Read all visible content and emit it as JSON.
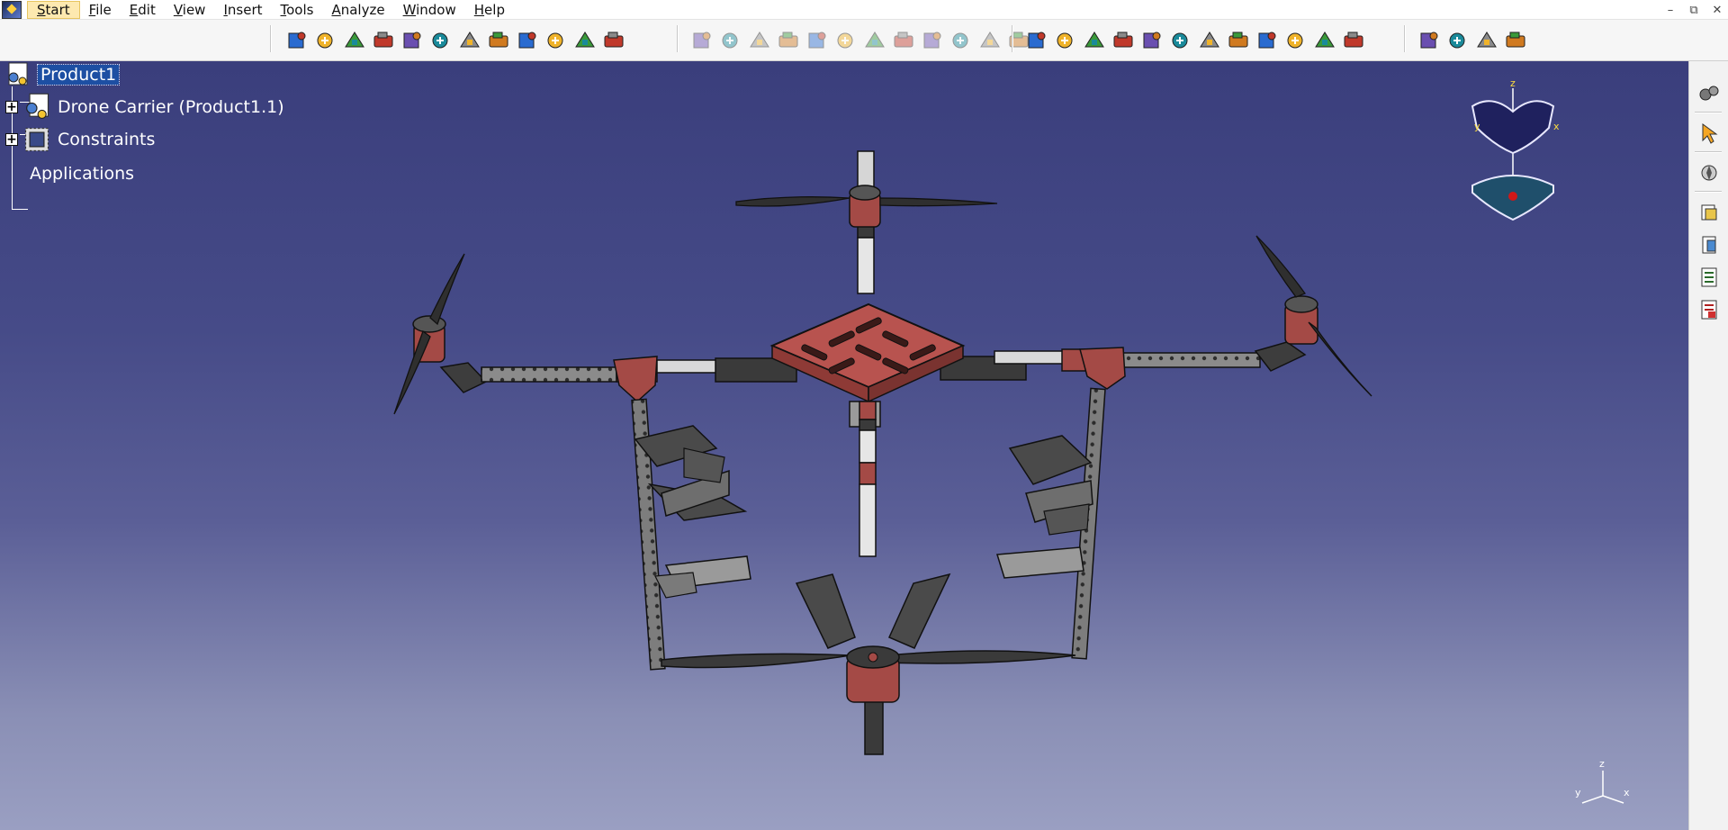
{
  "menu": {
    "items": [
      "Start",
      "File",
      "Edit",
      "View",
      "Insert",
      "Tools",
      "Analyze",
      "Window",
      "Help"
    ]
  },
  "tree": {
    "root": "Product1",
    "child_1": "Drone Carrier (Product1.1)",
    "child_2": "Constraints",
    "child_3": "Applications"
  },
  "compass": {
    "z_label": "z",
    "x_label": "x",
    "y_label": "y"
  },
  "axis": {
    "z_label": "z",
    "x_label": "x",
    "y_label": "y"
  },
  "toolbar_icons": [
    "fly-mode-icon",
    "fit-all-icon",
    "pan-icon",
    "rotate-icon",
    "zoom-in-icon",
    "zoom-out-icon",
    "normal-view-icon",
    "multi-view-icon",
    "iso-view-icon",
    "render-style-icon",
    "hide-show-icon",
    "swap-visible-icon",
    "manipulate-icon",
    "snap-icon",
    "explode-icon",
    "stop-manipulation-icon",
    "bill-of-material-icon",
    "measure-icon",
    "update-icon",
    "existing-component-icon",
    "new-part-icon",
    "new-product-icon",
    "new-component-icon",
    "replace-icon",
    "graph-tree-icon",
    "generate-numbering-icon",
    "selective-load-icon",
    "manage-representations-icon",
    "multi-instantiation-icon",
    "fast-instantiation-icon",
    "reorder-icon",
    "move-icon",
    "clash-icon",
    "sectioning-icon",
    "distance-icon",
    "catalog-icon",
    "analyze-icon",
    "simulation-icon",
    "fix-icon",
    "sparkle-icon"
  ],
  "right_toolbar_icons": [
    "gears-icon",
    "select-icon",
    "compass-icon",
    "part-icon",
    "body-icon",
    "tree-icon",
    "tree-update-icon"
  ],
  "colors": {
    "viewport_top": "#3a3e7c",
    "viewport_bottom": "#9a9fc2",
    "selection": "#1d4fa3",
    "frame_red": "#b8534f",
    "frame_dark": "#3a3a3a",
    "frame_white": "#e8e8e8"
  }
}
